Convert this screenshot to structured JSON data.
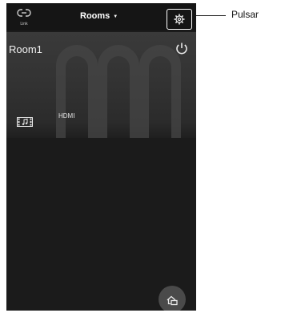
{
  "header": {
    "link_label": "Link",
    "rooms_title": "Rooms",
    "rooms_caret": "▼"
  },
  "room": {
    "name": "Room1",
    "source": "HDMI"
  },
  "icons": {
    "link": "link-icon",
    "settings": "gear-icon",
    "power": "power-icon",
    "source": "film-music-icon",
    "fab": "rooms-group-icon"
  },
  "annotation": {
    "label": "Pulsar"
  }
}
